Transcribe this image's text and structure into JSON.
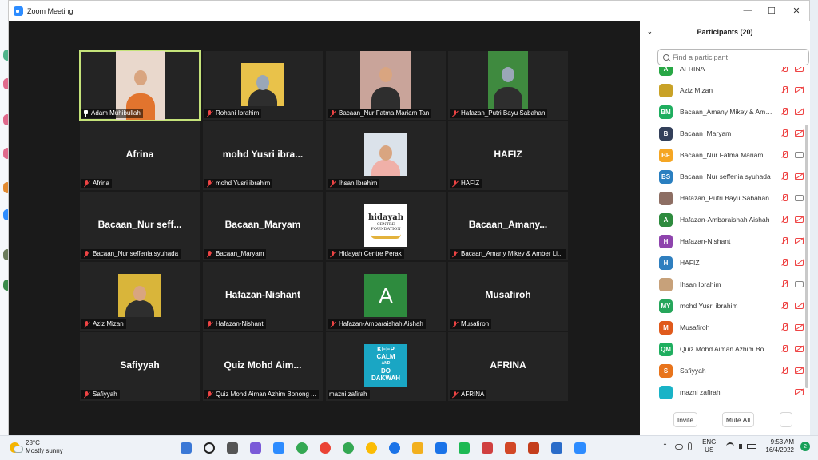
{
  "window": {
    "title": "Zoom Meeting",
    "minimize": "—",
    "maximize": "☐",
    "close": "✕"
  },
  "gallery": {
    "tiles": [
      {
        "name": "",
        "label": "Adam Muhibullah",
        "type": "video",
        "active": true,
        "pinned": true
      },
      {
        "name": "",
        "label": "Rohani Ibrahim",
        "type": "photo"
      },
      {
        "name": "",
        "label": "Bacaan_Nur Fatma Mariam Tan",
        "type": "video"
      },
      {
        "name": "",
        "label": "Hafazan_Putri Bayu Sabahan",
        "type": "photo"
      },
      {
        "name": "Afrina",
        "label": "Afrina",
        "type": "text"
      },
      {
        "name": "mohd Yusri ibra...",
        "label": "mohd Yusri ibrahim",
        "type": "text"
      },
      {
        "name": "",
        "label": "Ihsan Ibrahim",
        "type": "photo"
      },
      {
        "name": "HAFIZ",
        "label": "HAFIZ",
        "type": "text"
      },
      {
        "name": "Bacaan_Nur  seff...",
        "label": "Bacaan_Nur seffenia syuhada",
        "type": "text"
      },
      {
        "name": "Bacaan_Maryam",
        "label": "Bacaan_Maryam",
        "type": "text"
      },
      {
        "name": "",
        "label": "Hidayah Centre Perak",
        "type": "logo"
      },
      {
        "name": "Bacaan_Amany...",
        "label": "Bacaan_Amany Mikey & Amber Li...",
        "type": "text"
      },
      {
        "name": "",
        "label": "Aziz Mizan",
        "type": "photo"
      },
      {
        "name": "Hafazan-Nishant",
        "label": "Hafazan-Nishant",
        "type": "text"
      },
      {
        "name": "A",
        "label": "Hafazan-Ambaraishah Aishah",
        "type": "letter"
      },
      {
        "name": "Musafiroh",
        "label": "Musafiroh",
        "type": "text"
      },
      {
        "name": "Safiyyah",
        "label": "Safiyyah",
        "type": "text"
      },
      {
        "name": "Quiz  Mohd  Aim...",
        "label": "Quiz Mohd Aiman Azhim Bonong ...",
        "type": "text"
      },
      {
        "name": "",
        "label": "mazni zafirah",
        "type": "keepcalm"
      },
      {
        "name": "AFRINA",
        "label": "AFRINA",
        "type": "text"
      }
    ],
    "logo_text": {
      "line1": "hidayah",
      "line2": "CENTRE",
      "line3": "FOUNDATION"
    },
    "keepcalm": {
      "l1": "KEEP",
      "l2": "CALM",
      "l3": "AND",
      "l4": "DO",
      "l5": "DAKWAH"
    }
  },
  "panel": {
    "header": "Participants (20)",
    "search_placeholder": "Find a participant",
    "participants": [
      {
        "initials": "A",
        "name": "AFRINA",
        "color": "#28a745",
        "cam": "off"
      },
      {
        "initials": "",
        "name": "Aziz Mizan",
        "color": "#c9a227",
        "cam": "off",
        "photo": true
      },
      {
        "initials": "BM",
        "name": "Bacaan_Amany Mikey & Amber ...",
        "color": "#1fae5f",
        "cam": "off"
      },
      {
        "initials": "B",
        "name": "Bacaan_Maryam",
        "color": "#33405a",
        "cam": "off"
      },
      {
        "initials": "BF",
        "name": "Bacaan_Nur Fatma Mariam Tan",
        "color": "#f5a623",
        "cam": "on"
      },
      {
        "initials": "BS",
        "name": "Bacaan_Nur seffenia syuhada",
        "color": "#2a7fc0",
        "cam": "off"
      },
      {
        "initials": "",
        "name": "Hafazan_Putri Bayu Sabahan",
        "color": "#8d6e63",
        "cam": "on",
        "photo": true
      },
      {
        "initials": "A",
        "name": "Hafazan-Ambaraishah Aishah",
        "color": "#2e8b3e",
        "cam": "off"
      },
      {
        "initials": "H",
        "name": "Hafazan-Nishant",
        "color": "#8e44ad",
        "cam": "off"
      },
      {
        "initials": "H",
        "name": "HAFIZ",
        "color": "#2f7fbf",
        "cam": "off"
      },
      {
        "initials": "",
        "name": "Ihsan Ibrahim",
        "color": "#c7a17a",
        "cam": "on",
        "photo": true
      },
      {
        "initials": "MY",
        "name": "mohd Yusri ibrahim",
        "color": "#26a65b",
        "cam": "off"
      },
      {
        "initials": "M",
        "name": "Musafiroh",
        "color": "#e05a1c",
        "cam": "off"
      },
      {
        "initials": "QM",
        "name": "Quiz Mohd Aiman Azhim Bonon...",
        "color": "#1fae5f",
        "cam": "off"
      },
      {
        "initials": "S",
        "name": "Safiyyah",
        "color": "#e8741c",
        "cam": "off"
      },
      {
        "initials": "",
        "name": "mazni zafirah",
        "color": "#19b3c7",
        "cam": "off",
        "photo": true,
        "nomic": true
      }
    ],
    "invite": "Invite",
    "mute_all": "Mute All",
    "more": "..."
  },
  "taskbar": {
    "temp": "28°C",
    "weather": "Mostly sunny",
    "lang1": "ENG",
    "lang2": "US",
    "time": "9:53 AM",
    "date": "16/4/2022",
    "notif_count": "2"
  }
}
